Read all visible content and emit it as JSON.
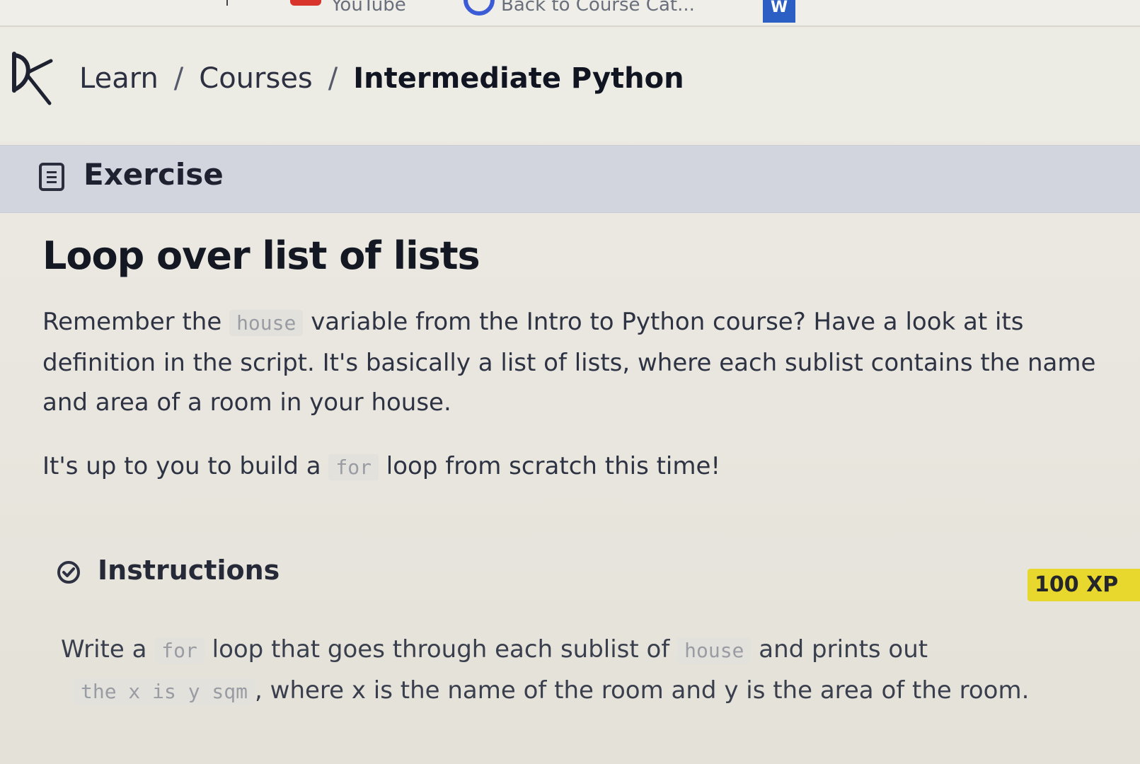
{
  "bookmarks": {
    "items": [
      {
        "label": "YouTube",
        "icon": "youtube-icon"
      },
      {
        "label": "Back to Course Cat...",
        "icon": "course-ring-icon"
      },
      {
        "label": "W",
        "icon": "word-icon"
      }
    ]
  },
  "header": {
    "logo_icon": "datacamp-logo-icon",
    "breadcrumb": {
      "learn": "Learn",
      "courses": "Courses",
      "separator": "/",
      "current": "Intermediate Python"
    }
  },
  "exercise_band": {
    "icon": "document-icon",
    "title": "Exercise"
  },
  "exercise": {
    "heading": "Loop over list of lists",
    "paragraph1": {
      "before_code": "Remember the",
      "code": "house",
      "after_code": "variable from the Intro to Python course? Have a look at its definition in the script. It's basically a list of lists, where each sublist contains the name and area of a room in your house."
    },
    "paragraph2": {
      "before_code": "It's up to you to build a",
      "code": "for",
      "after_code": "loop from scratch this time!"
    }
  },
  "instructions": {
    "icon": "check-circle-icon",
    "title": "Instructions",
    "xp": "100 XP",
    "accent_color": "#e8d72c",
    "text": {
      "part1": "Write a",
      "code1": "for",
      "part2": "loop that goes through each sublist of",
      "code2": "house",
      "part3": "and prints out",
      "code3": "the x is y sqm",
      "part4": ", where x is the name of the room and y is the area of the room."
    }
  }
}
